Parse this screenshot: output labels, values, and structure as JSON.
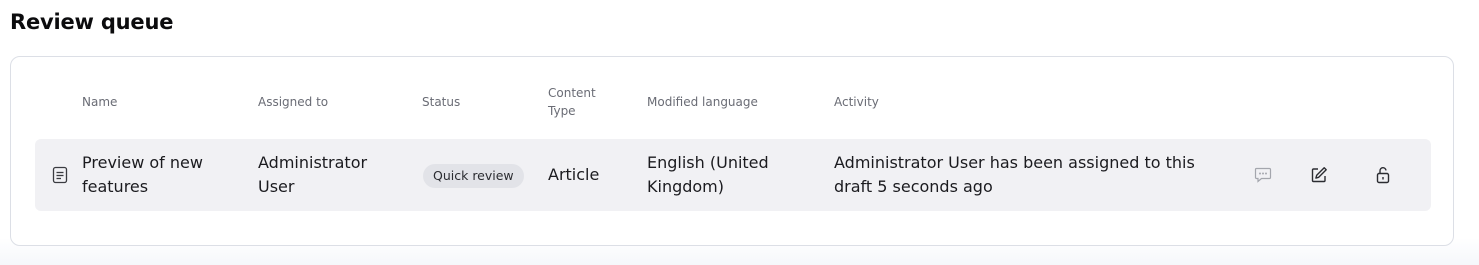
{
  "page": {
    "title": "Review queue"
  },
  "table": {
    "headers": {
      "name": "Name",
      "assigned_to": "Assigned to",
      "status": "Status",
      "content_type_line1": "Content",
      "content_type_line2": "Type",
      "modified_language": "Modified language",
      "activity": "Activity"
    },
    "rows": [
      {
        "row_icon": "document-icon",
        "name_line1": "Preview of new",
        "name_line2": "features",
        "assigned_line1": "Administrator",
        "assigned_line2": "User",
        "status": "Quick review",
        "content_type": "Article",
        "language_line1": "English (United",
        "language_line2": "Kingdom)",
        "activity_line1": "Administrator User has been assigned to this",
        "activity_line2": "draft 5 seconds ago",
        "actions": [
          "comment-icon",
          "edit-icon",
          "unlock-icon"
        ]
      }
    ]
  },
  "colors": {
    "row_bg": "#f1f1f4",
    "badge_bg": "#e2e3e8",
    "header_text": "#6a6c75"
  }
}
